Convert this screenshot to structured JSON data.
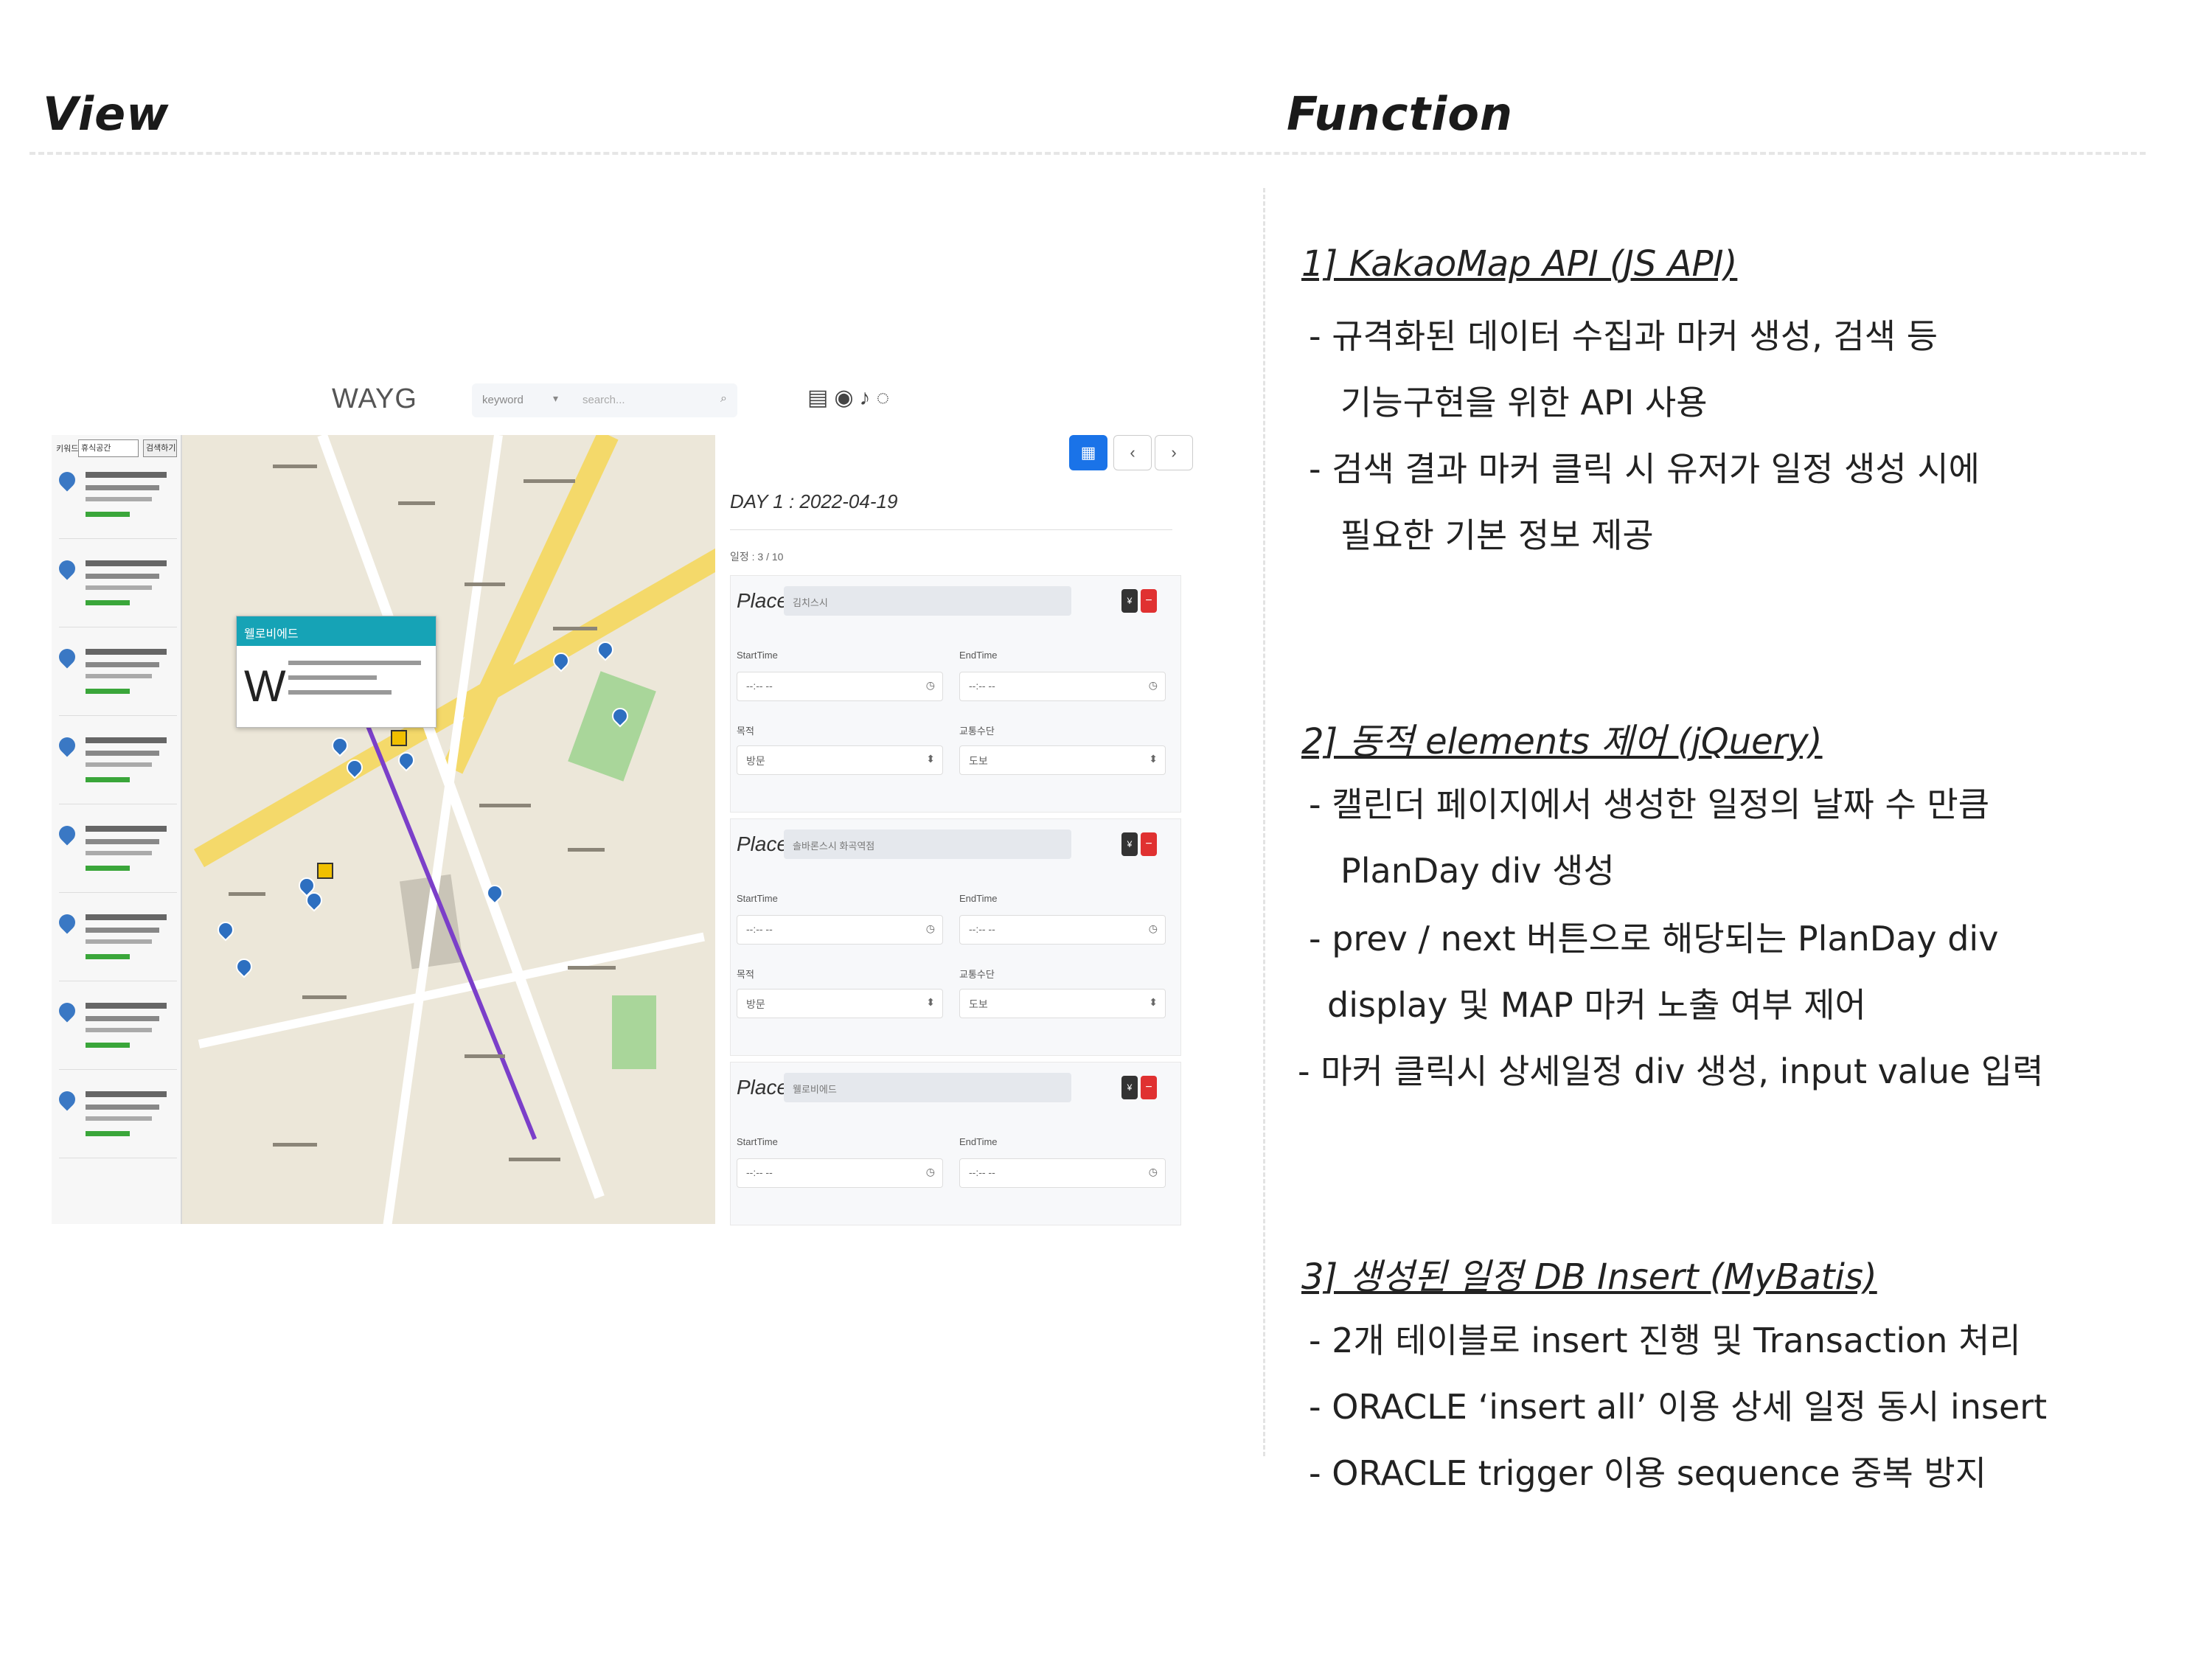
{
  "view_heading": "View",
  "function_heading": "Function",
  "app": {
    "brand": "WAYG",
    "search": {
      "category": "keyword",
      "placeholder": "search..."
    },
    "list_top_label": "키워드",
    "list_top_input": "휴식공간",
    "list_top_button": "검색하기",
    "infowindow_title": "웰로비에드",
    "infowindow_logo": "W",
    "plan": {
      "calendar_button": "▦",
      "prev_button": "‹",
      "next_button": "›",
      "day_title": "DAY 1 : 2022-04-19",
      "count_text": "일정 : 3 / 10",
      "place_label": "Place",
      "start_label": "StartTime",
      "end_label": "EndTime",
      "purpose_label": "목적",
      "transport_label": "교통수단",
      "time_placeholder": "--:-- --",
      "cards": [
        {
          "place": "김치스시",
          "purpose": "방문",
          "transport": "도보"
        },
        {
          "place": "솔바론스시 화곡역점",
          "purpose": "방문",
          "transport": "도보"
        },
        {
          "place": "웰로비에드"
        }
      ]
    }
  },
  "functions": {
    "s1": {
      "title": "1] KakaoMap API (JS API)",
      "lines": [
        "- 규격화된 데이터 수집과 마커 생성, 검색 등",
        "기능구현을 위한 API 사용",
        "- 검색 결과 마커 클릭 시 유저가 일정 생성 시에",
        "필요한 기본 정보 제공"
      ]
    },
    "s2": {
      "title": "2] 동적 elements 제어 (jQuery)",
      "lines": [
        "- 캘린더 페이지에서 생성한 일정의 날짜 수 만큼",
        "PlanDay div 생성",
        "- prev / next 버튼으로 해당되는 PlanDay div",
        "display 및 MAP 마커 노출 여부 제어",
        "- 마커 클릭시 상세일정 div 생성, input value 입력"
      ]
    },
    "s3": {
      "title": "3] 생성된 일정 DB Insert (MyBatis)",
      "lines": [
        "- 2개 테이블로 insert 진행 및 Transaction 처리",
        "- ORACLE ‘insert all’ 이용 상세 일정 동시 insert",
        "- ORACLE trigger 이용 sequence 중복 방지"
      ]
    }
  }
}
